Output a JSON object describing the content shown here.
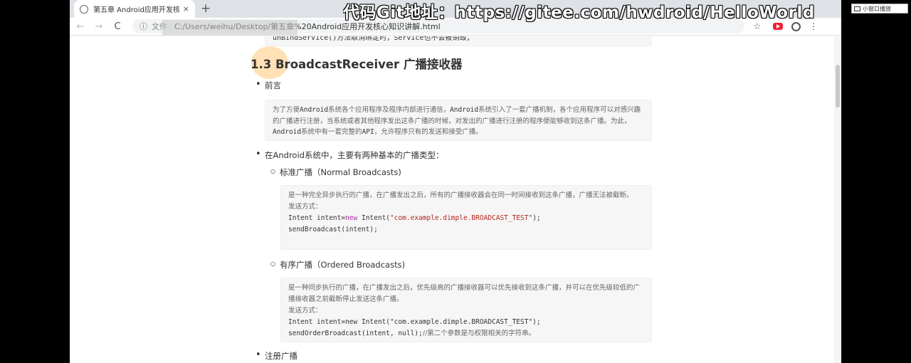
{
  "browser": {
    "tab_title": "第五章 Android应用开发核心知",
    "tab_close": "×",
    "new_tab": "+",
    "nav": {
      "back": "←",
      "forward": "→",
      "reload": "C"
    },
    "address": {
      "info_label": "文件",
      "url": "C:/Users/weihu/Desktop/第五章%20Android应用开发核心知识讲解.html"
    },
    "bookmark_icon": "star-icon",
    "menu_icon": "⋮"
  },
  "overlay": {
    "watermark": "代码Git地址：https://gitee.com/hwdroid/HelloWorld",
    "mini_window": "小窗口播放"
  },
  "page": {
    "prev_code": "unBindService()方法取消绑定时，Service也不会被销毁；",
    "heading": "1.3 BroadcastReceiver 广播接收器",
    "preface_label": "前言",
    "preface_text_1": "为了方便",
    "preface_android": "Android",
    "preface_text_2": "系统各个应用程序及程序内部进行通信，",
    "preface_text_3": "系统引入了一套广播机制，各个应用程序可以对感兴趣的广播进行注册，当系统或者其他程序发出这条广播的时候，对发出的广播进行注册的程序便能够收到这条广播。为此，",
    "preface_text_4": "系统中有一套完整的",
    "preface_api": "API",
    "preface_text_5": "，允许程序只有的发送和接受广播。",
    "types_label": "在Android系统中，主要有两种基本的广播类型：",
    "normal": {
      "label": "标准广播（Normal Broadcasts)",
      "desc": "是一种完全异步执行的广播，在广播发出之后，所有的广播接收器会在同一时间接收到这条广播，广播无法被截断。",
      "send_label": "发送方式：",
      "code_1_pre": "Intent intent=",
      "code_1_kw": "new",
      "code_1_mid": " Intent(",
      "code_1_str": "\"com.example.dimple.BROADCAST_TEST\"",
      "code_1_end": ");",
      "code_2": "sendBroadcast(intent);"
    },
    "ordered": {
      "label": "有序广播（Ordered Broadcasts)",
      "desc": "是一种同步执行的广播，在广播发出之后，优先级高的广播接收器可以优先接收到这条广播，并可以在优先级较低的广播接收器之前截断停止发送这条广播。",
      "send_label": "发送方式：",
      "code_1": "Intent intent=new Intent(\"com.example.dimple.BROADCAST_TEST\");",
      "code_2": "sendOrderBroadcast(intent, null);",
      "code_2_comment": "//第二个参数是与权限相关的字符串。"
    },
    "register_label": "注册广播"
  }
}
